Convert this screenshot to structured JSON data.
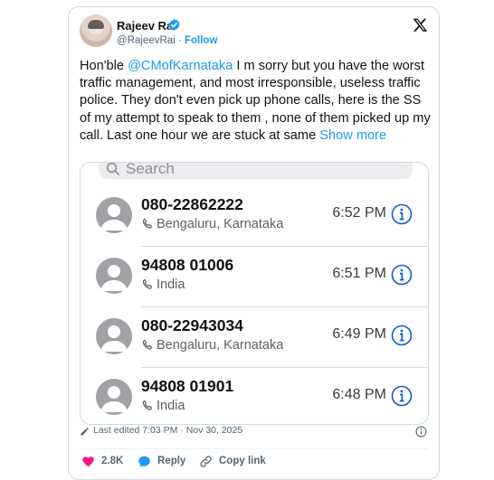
{
  "author": {
    "name": "Rajeev Rai",
    "handle": "@RajeevRai",
    "separator": "·",
    "follow_label": "Follow"
  },
  "tweet": {
    "text_prefix": "Hon'ble ",
    "mention": "@CMofKarnataka",
    "text_body": " I m sorry but you have the worst traffic management, and most irresponsible, useless traffic police. They don't even pick up phone calls, here is the SS of my attempt to speak to them , none of them picked up my call. Last one hour we are stuck at same ",
    "show_more": "Show more"
  },
  "screenshot": {
    "search_placeholder": "Search",
    "calls": [
      {
        "number": "080-22862222",
        "location": "Bengaluru, Karnataka",
        "time": "6:52 PM"
      },
      {
        "number": "94808 01006",
        "location": "India",
        "time": "6:51 PM"
      },
      {
        "number": "080-22943034",
        "location": "Bengaluru, Karnataka",
        "time": "6:49 PM"
      },
      {
        "number": "94808 01901",
        "location": "India",
        "time": "6:48 PM"
      }
    ]
  },
  "meta": {
    "edited": "Last edited 7:03 PM · Nov 30, 2025"
  },
  "actions": {
    "likes": "2.8K",
    "reply_label": "Reply",
    "copy_link_label": "Copy link"
  },
  "colors": {
    "accent": "#1d9bf0",
    "like": "#f91880",
    "ios_blue": "#0a5bd8",
    "avatar_gray": "#a1a1a6"
  },
  "icons": [
    "verified-badge-icon",
    "x-logo-icon",
    "search-icon",
    "phone-icon",
    "info-icon",
    "pencil-icon",
    "heart-icon",
    "reply-bubble-icon",
    "link-icon"
  ]
}
